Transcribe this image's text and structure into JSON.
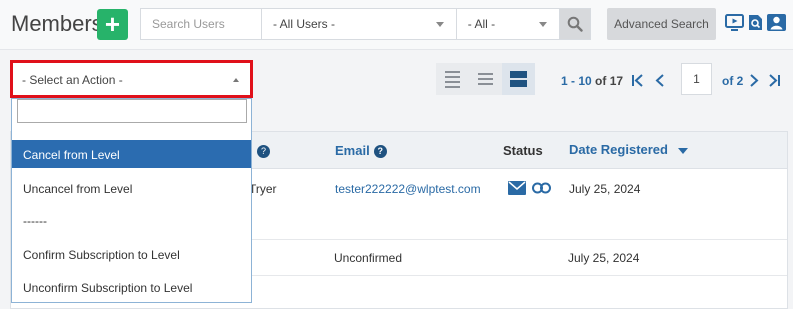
{
  "header": {
    "title": "Members",
    "add_label": "+",
    "search_placeholder": "Search Users",
    "users_filter": "- All Users -",
    "status_filter": "- All -",
    "advanced_search": "Advanced Search"
  },
  "toolbar": {
    "action_select": "- Select an Action -",
    "range": "1 - 10",
    "of_label": "of",
    "total": "17",
    "page": "1",
    "of_pages": "of 2"
  },
  "dropdown": {
    "items": [
      "Cancel from Level",
      "Uncancel from Level",
      "------",
      "Confirm Subscription to Level",
      "Unconfirm Subscription to Level"
    ]
  },
  "table": {
    "headers": {
      "email": "Email",
      "status": "Status",
      "date": "Date Registered"
    },
    "rows": [
      {
        "name_tail": "Tryer",
        "email": "tester222222@wlptest.com",
        "status_text": "",
        "date": "July 25, 2024"
      },
      {
        "name_tail": "",
        "email": "Unconfirmed",
        "status_text": "",
        "date": "July 25, 2024"
      }
    ]
  },
  "colors": {
    "accent_green": "#27b36a",
    "link_blue": "#2a6aa5",
    "highlight_blue": "#2b6cb0",
    "focus_red": "#e0101a"
  }
}
